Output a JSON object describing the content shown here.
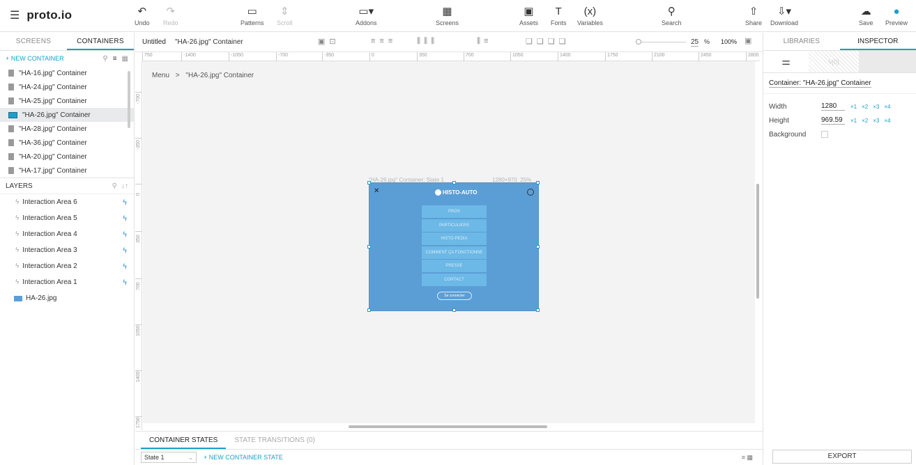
{
  "app": {
    "logo": "proto.io"
  },
  "toolbar": {
    "undo": "Undo",
    "redo": "Redo",
    "patterns": "Patterns",
    "scroll": "Scroll",
    "addons": "Addons",
    "screens": "Screens",
    "assets": "Assets",
    "fonts": "Fonts",
    "variables": "Variables",
    "variables_icon": "(x)",
    "fonts_icon": "T",
    "search": "Search",
    "share": "Share",
    "download": "Download",
    "save": "Save",
    "preview": "Preview"
  },
  "left": {
    "tabs": [
      "SCREENS",
      "CONTAINERS"
    ],
    "new_container": "+ NEW CONTAINER",
    "containers": [
      "\"HA-16.jpg\" Container",
      "\"HA-24.jpg\" Container",
      "\"HA-25.jpg\" Container",
      "\"HA-26.jpg\" Container",
      "\"HA-28.jpg\" Container",
      "\"HA-36.jpg\" Container",
      "\"HA-20.jpg\" Container",
      "\"HA-17.jpg\" Container"
    ],
    "selected_index": 3,
    "layers_title": "LAYERS",
    "layers": [
      "Interaction Area 6",
      "Interaction Area 5",
      "Interaction Area 4",
      "Interaction Area 3",
      "Interaction Area 2",
      "Interaction Area 1"
    ],
    "image_layer": "HA-26.jpg"
  },
  "canvas": {
    "doc_title": "Untitled",
    "container_name": "\"HA-26.jpg\" Container",
    "zoom": "25",
    "zoom_unit": "%",
    "zoom_full": "100%",
    "ruler_h": [
      "750",
      "-1400",
      "-1050",
      "-700",
      "-350",
      "0",
      "350",
      "700",
      "1050",
      "1400",
      "1750",
      "2100",
      "2450",
      "2800"
    ],
    "ruler_v": [
      "-700",
      "-350",
      "0",
      "350",
      "700",
      "1050",
      "1400",
      "1750"
    ],
    "breadcrumb": [
      "Menu",
      "\"HA-26.jpg\" Container"
    ],
    "breadcrumb_sep": ">",
    "art_label": "\"HA-26.jpg\" Container: State 1",
    "art_size": "1280×970",
    "art_zoom": "25%",
    "art": {
      "brand": "HISTO-AUTO",
      "menu": [
        "PROS",
        "PARTICULIERS",
        "HISTO-PEDIA",
        "COMMENT ÇA FONCTIONNE",
        "PRESSE",
        "CONTACT"
      ],
      "connect": "Se connecter"
    }
  },
  "bottom": {
    "tabs": [
      "CONTAINER STATES",
      "STATE TRANSITIONS (0)"
    ],
    "state": "State 1",
    "new_state": "+ NEW CONTAINER STATE"
  },
  "right": {
    "tabs": [
      "LIBRARIES",
      "INSPECTOR"
    ],
    "sub_badge": "(0)",
    "container_title": "Container: \"HA-26.jpg\" Container",
    "width_label": "Width",
    "width": "1280",
    "height_label": "Height",
    "height": "969.59",
    "multipliers": [
      "×1",
      "×2",
      "×3",
      "×4"
    ],
    "background_label": "Background",
    "export": "EXPORT"
  },
  "colors": {
    "accent": "#1aa0c8",
    "art_bg": "#5b9ed6",
    "menu_btn": "#6cb8e6"
  }
}
